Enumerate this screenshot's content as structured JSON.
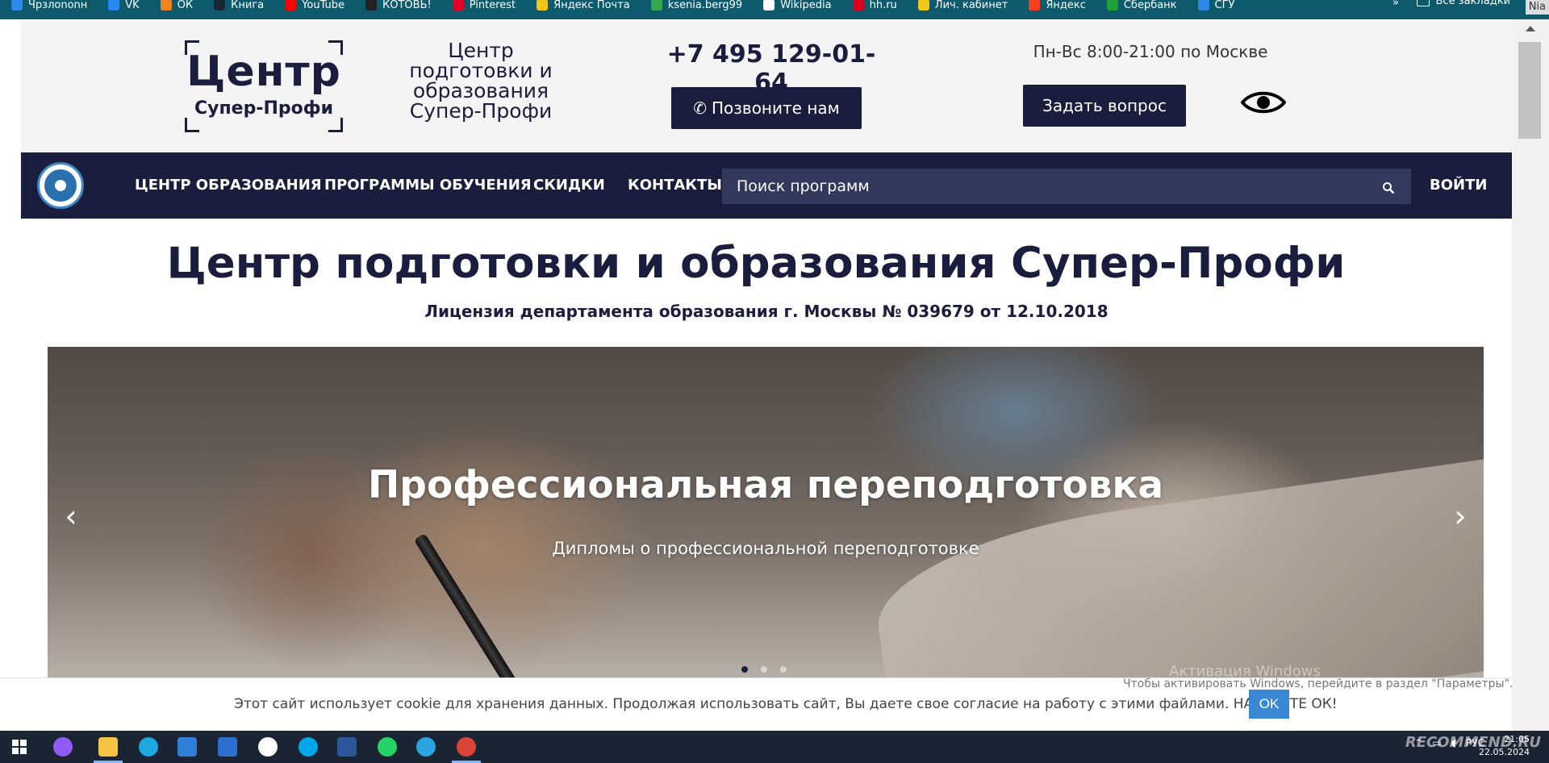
{
  "bookmarks": [
    {
      "label": "Чрзлononн",
      "color": "#2e88e8"
    },
    {
      "label": "VK",
      "color": "#2787f5"
    },
    {
      "label": "ОК",
      "color": "#f48420"
    },
    {
      "label": "Книга",
      "color": "#1b2433"
    },
    {
      "label": "YouTube",
      "color": "#ff0000"
    },
    {
      "label": "КОТОВЬ!",
      "color": "#222222"
    },
    {
      "label": "Pinterest",
      "color": "#e60023"
    },
    {
      "label": "Яндекс Почта",
      "color": "#f5c518"
    },
    {
      "label": "ksenia.berg99",
      "color": "#34a853"
    },
    {
      "label": "Wikipedia",
      "color": "#ffffff"
    },
    {
      "label": "hh.ru",
      "color": "#d6001c"
    },
    {
      "label": "Лич. кабинет",
      "color": "#f5c518"
    },
    {
      "label": "Яндекс",
      "color": "#fc3f1d"
    },
    {
      "label": "Сбербанк",
      "color": "#21a038"
    },
    {
      "label": "СГУ",
      "color": "#2e88e8"
    }
  ],
  "bookmarks_more": "»",
  "all_bookmarks": "Все закладки",
  "corner_tag": "Nia",
  "header": {
    "logo_line1": "Центр",
    "logo_line2": "Супер-Профи",
    "logo_text": "Центр подготовки и образования Супер-Профи",
    "phone": "+7 495 129-01-64",
    "call_button": "Позвоните нам",
    "hours": "Пн-Вс 8:00-21:00 по Москве",
    "ask_button": "Задать вопрос"
  },
  "nav": {
    "items": [
      "ЦЕНТР ОБРАЗОВАНИЯ",
      "ПРОГРАММЫ ОБУЧЕНИЯ",
      "СКИДКИ",
      "КОНТАКТЫ"
    ],
    "search_placeholder": "Поиск программ",
    "login": "ВОЙТИ"
  },
  "main": {
    "title": "Центр подготовки и образования Супер-Профи",
    "license": "Лицензия департамента образования г. Москвы № 039679 от 12.10.2018"
  },
  "carousel": {
    "slide_title": "Профессиональная переподготовка",
    "slide_subtitle": "Дипломы о профессиональной переподготовке",
    "prev": "‹",
    "next": "›",
    "slides_total": 3,
    "active_slide": 1,
    "watermark": "Активация Windows"
  },
  "cookie": {
    "text": "Этот сайт использует cookie для хранения данных. Продолжая использовать сайт, Вы даете свое согласие на работу с этими файлами. НАЖМИТЕ ОК!",
    "ok_button": "OK",
    "activation_hint": "Чтобы активировать Windows, перейдите в раздел \"Параметры\"."
  },
  "taskbar": {
    "language": "РУС",
    "time": "21:05",
    "date": "22.05.2024",
    "brand": "RECOMMEND.RU"
  }
}
